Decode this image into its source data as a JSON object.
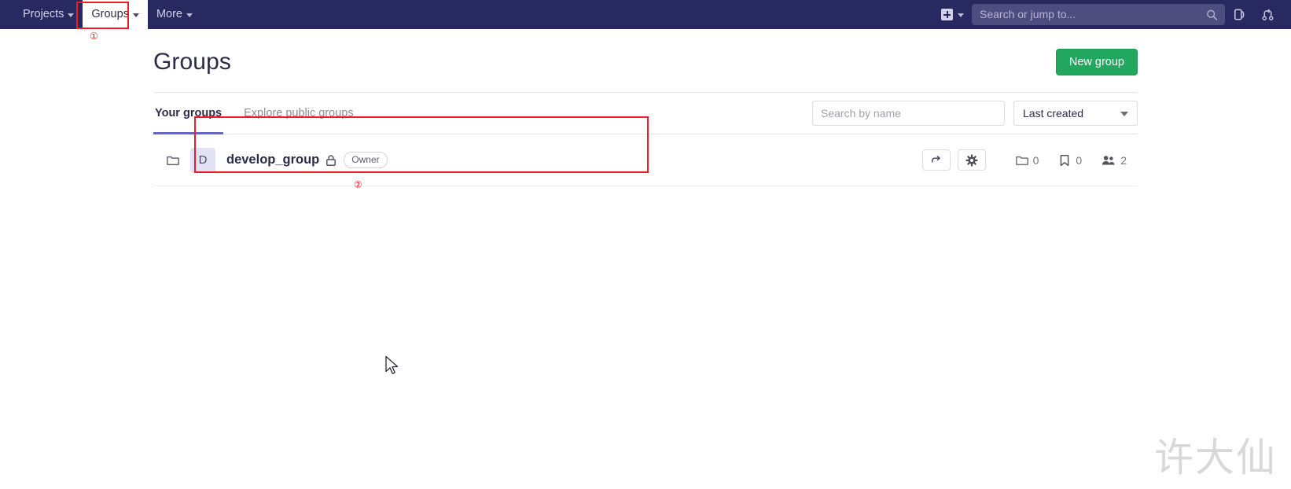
{
  "navbar": {
    "items": [
      {
        "label": "Projects",
        "icon": "chevron-down-icon",
        "active": false
      },
      {
        "label": "Groups",
        "icon": "chevron-down-icon",
        "active": true
      },
      {
        "label": "More",
        "icon": "chevron-down-icon",
        "active": false
      }
    ],
    "create_new_icon": "plus-square-icon",
    "create_new_caret": "chevron-down-icon",
    "search": {
      "placeholder": "Search or jump to...",
      "icon": "search-icon"
    },
    "right_icons": [
      {
        "name": "issues-icon"
      },
      {
        "name": "merge-requests-icon"
      }
    ],
    "background_color": "#292961"
  },
  "page": {
    "title": "Groups",
    "new_group_button": "New group",
    "new_group_color": "#22a85e"
  },
  "tabs": [
    {
      "label": "Your groups",
      "active": true
    },
    {
      "label": "Explore public groups",
      "active": false
    }
  ],
  "filters": {
    "search_placeholder": "Search by name",
    "search_value": "",
    "sort_selected": "Last created",
    "sort_caret": "chevron-down-icon"
  },
  "groups": [
    {
      "folder_icon": "folder-icon",
      "avatar_letter": "D",
      "name": "develop_group",
      "visibility_icon": "lock-icon",
      "role_badge": "Owner",
      "actions": [
        {
          "name": "leave-group-button",
          "icon": "leave-icon"
        },
        {
          "name": "group-settings-button",
          "icon": "gear-icon"
        }
      ],
      "stats": [
        {
          "name": "subgroups-count",
          "icon": "folder-icon",
          "value": "0"
        },
        {
          "name": "projects-count",
          "icon": "bookmark-icon",
          "value": "0"
        },
        {
          "name": "members-count",
          "icon": "members-icon",
          "value": "2"
        }
      ]
    }
  ],
  "annotations": [
    {
      "id": "1",
      "label": "①",
      "target": "groups-nav-item"
    },
    {
      "id": "2",
      "label": "②",
      "target": "group-row"
    }
  ],
  "watermark": "许大仙",
  "accent_colors": {
    "navbar": "#292961",
    "primary_green": "#22a85e",
    "tab_underline": "#6666c4",
    "annotation_red": "#ee1c25"
  }
}
